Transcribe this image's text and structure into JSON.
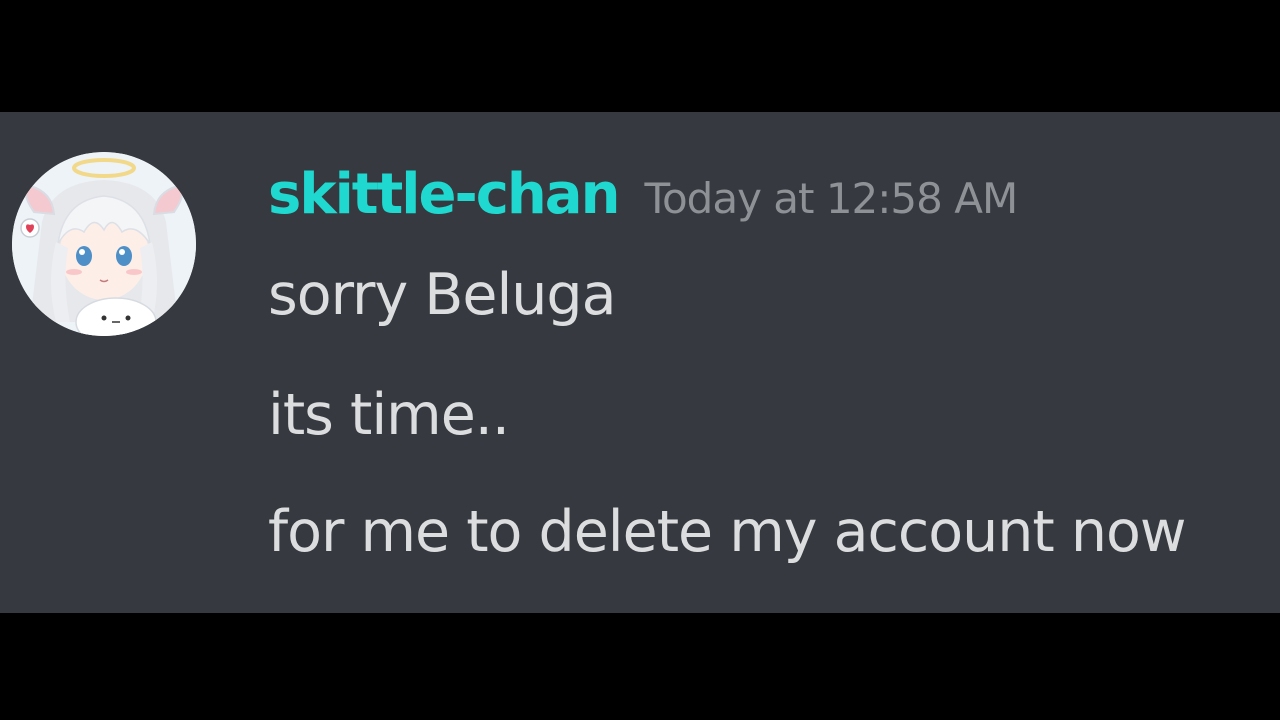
{
  "message": {
    "author": {
      "username": "skittle-chan",
      "avatar_icon": "anime-girl-avatar-icon",
      "username_color": "#1fd8cf"
    },
    "timestamp": "Today at 12:58 AM",
    "lines": [
      "sorry Beluga",
      "its time..",
      "for me to delete my account now"
    ]
  },
  "theme": {
    "background": "#36393f",
    "letterbox": "#000000",
    "text_color": "#dcddde",
    "timestamp_color": "#8e9297"
  }
}
